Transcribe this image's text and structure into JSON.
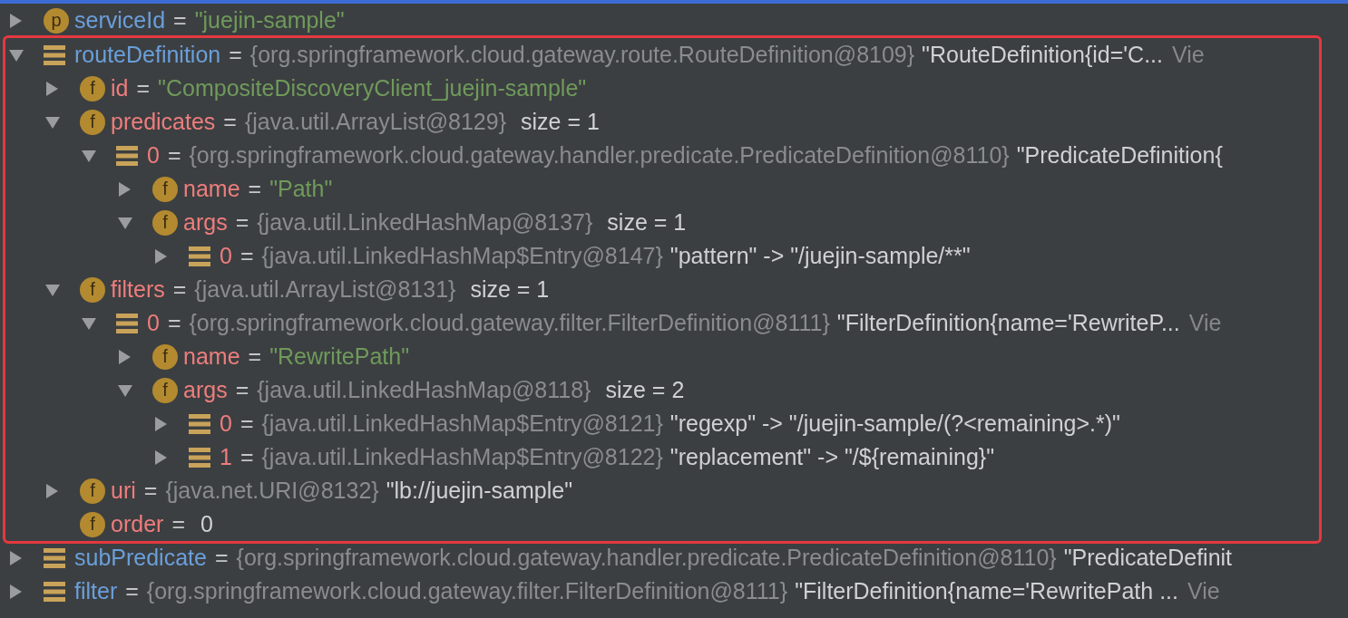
{
  "rows": [
    {
      "expanded": false,
      "kind": "property",
      "badge": "p",
      "name": "serviceId",
      "eq": "=",
      "string_value": "\"juejin-sample\""
    },
    {
      "expanded": true,
      "highlighted": true,
      "kind": "object",
      "name": "routeDefinition",
      "eq": "=",
      "ref": "{org.springframework.cloud.gateway.route.RouteDefinition@8109}",
      "display": "\"RouteDefinition{id='C...",
      "view": "Vie",
      "children": [
        {
          "expanded": false,
          "kind": "field",
          "badge": "f",
          "name": "id",
          "eq": "=",
          "string_value": "\"CompositeDiscoveryClient_juejin-sample\""
        },
        {
          "expanded": true,
          "kind": "field",
          "badge": "f",
          "name": "predicates",
          "eq": "=",
          "ref": "{java.util.ArrayList@8129}",
          "size": "size = 1",
          "children": [
            {
              "expanded": true,
              "kind": "element",
              "name": "0",
              "eq": "=",
              "ref": "{org.springframework.cloud.gateway.handler.predicate.PredicateDefinition@8110}",
              "display": "\"PredicateDefinition{",
              "children": [
                {
                  "expanded": false,
                  "kind": "field",
                  "badge": "f",
                  "name": "name",
                  "eq": "=",
                  "string_value": "\"Path\""
                },
                {
                  "expanded": true,
                  "kind": "field",
                  "badge": "f",
                  "name": "args",
                  "eq": "=",
                  "ref": "{java.util.LinkedHashMap@8137}",
                  "size": "size = 1",
                  "children": [
                    {
                      "expanded": false,
                      "kind": "element",
                      "name": "0",
                      "eq": "=",
                      "ref": "{java.util.LinkedHashMap$Entry@8147}",
                      "display": "\"pattern\" -> \"/juejin-sample/**\""
                    }
                  ]
                }
              ]
            }
          ]
        },
        {
          "expanded": true,
          "kind": "field",
          "badge": "f",
          "name": "filters",
          "eq": "=",
          "ref": "{java.util.ArrayList@8131}",
          "size": "size = 1",
          "children": [
            {
              "expanded": true,
              "kind": "element",
              "name": "0",
              "eq": "=",
              "ref": "{org.springframework.cloud.gateway.filter.FilterDefinition@8111}",
              "display": "\"FilterDefinition{name='RewriteP...",
              "view": "Vie",
              "children": [
                {
                  "expanded": false,
                  "kind": "field",
                  "badge": "f",
                  "name": "name",
                  "eq": "=",
                  "string_value": "\"RewritePath\""
                },
                {
                  "expanded": true,
                  "kind": "field",
                  "badge": "f",
                  "name": "args",
                  "eq": "=",
                  "ref": "{java.util.LinkedHashMap@8118}",
                  "size": "size = 2",
                  "children": [
                    {
                      "expanded": false,
                      "kind": "element",
                      "name": "0",
                      "eq": "=",
                      "ref": "{java.util.LinkedHashMap$Entry@8121}",
                      "display": "\"regexp\" -> \"/juejin-sample/(?<remaining>.*)\""
                    },
                    {
                      "expanded": false,
                      "kind": "element",
                      "name": "1",
                      "eq": "=",
                      "ref": "{java.util.LinkedHashMap$Entry@8122}",
                      "display": "\"replacement\" -> \"/${remaining}\""
                    }
                  ]
                }
              ]
            }
          ]
        },
        {
          "expanded": false,
          "kind": "field",
          "badge": "f",
          "name": "uri",
          "eq": "=",
          "ref": "{java.net.URI@8132}",
          "display": "\"lb://juejin-sample\""
        },
        {
          "kind": "field",
          "badge": "f",
          "name": "order",
          "eq": "=",
          "display": "0"
        }
      ]
    },
    {
      "expanded": false,
      "kind": "object",
      "name": "subPredicate",
      "eq": "=",
      "ref": "{org.springframework.cloud.gateway.handler.predicate.PredicateDefinition@8110}",
      "display": "\"PredicateDefinit"
    },
    {
      "expanded": false,
      "kind": "object",
      "name": "filter",
      "eq": "=",
      "ref": "{org.springframework.cloud.gateway.filter.FilterDefinition@8111}",
      "display": "\"FilterDefinition{name='RewritePath ...",
      "view": "Vie"
    }
  ]
}
